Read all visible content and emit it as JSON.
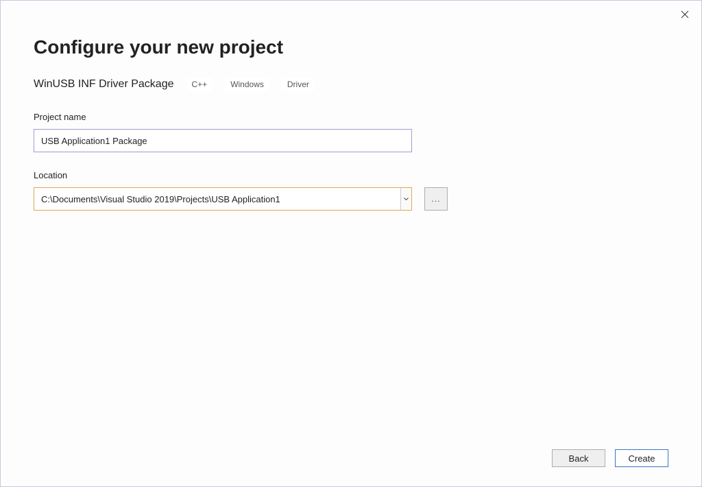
{
  "dialog": {
    "title": "Configure your new project",
    "template_name": "WinUSB INF Driver Package",
    "tags": [
      "C++",
      "Windows",
      "Driver"
    ]
  },
  "fields": {
    "project_name_label": "Project name",
    "project_name_value": "USB Application1 Package",
    "location_label": "Location",
    "location_value": "C:\\Documents\\Visual Studio 2019\\Projects\\USB Application1",
    "browse_label": "..."
  },
  "buttons": {
    "back": "Back",
    "create": "Create"
  }
}
